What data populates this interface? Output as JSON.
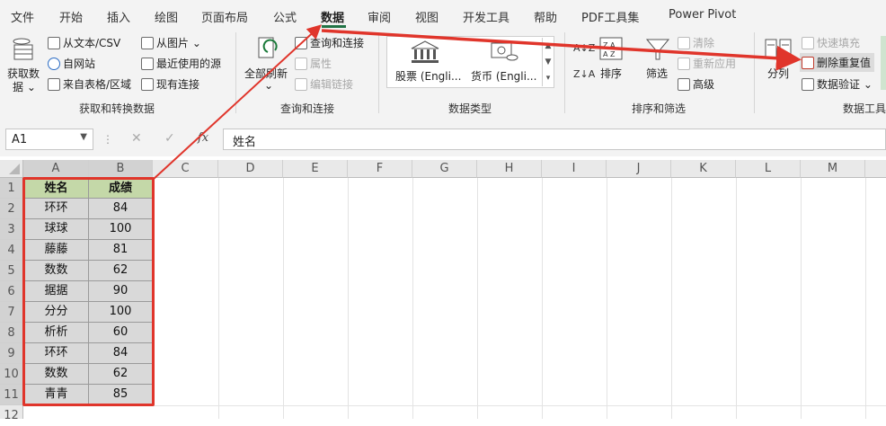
{
  "menu": [
    "文件",
    "开始",
    "插入",
    "绘图",
    "页面布局",
    "公式",
    "数据",
    "审阅",
    "视图",
    "开发工具",
    "帮助",
    "PDF工具集",
    "Power Pivot"
  ],
  "active_tab_index": 6,
  "ribbon": {
    "get_data": {
      "label_top": "获取数",
      "label_bottom": "据 ⌄"
    },
    "from_text_csv": "从文本/CSV",
    "from_web": "自网站",
    "from_table": "来自表格/区域",
    "from_picture": "从图片 ⌄",
    "recent_sources": "最近使用的源",
    "existing_connections": "现有连接",
    "group1": "获取和转换数据",
    "refresh_all": {
      "label_top": "全部刷新",
      "label_bottom": "⌄"
    },
    "queries_connections": "查询和连接",
    "properties": "属性",
    "edit_links": "编辑链接",
    "group2": "查询和连接",
    "stocks": "股票 (Engli...",
    "currency": "货币 (Engli...",
    "group3": "数据类型",
    "sort_az": "A↓Z",
    "sort_za": "Z↓A",
    "sort": "排序",
    "filter": "筛选",
    "clear": "清除",
    "reapply": "重新应用",
    "advanced": "高级",
    "group4": "排序和筛选",
    "text_to_columns": "分列",
    "flash_fill": "快速填充",
    "remove_duplicates": "删除重复值",
    "data_validation": "数据验证 ⌄",
    "group5": "数据工具"
  },
  "formula_bar": {
    "name_box": "A1",
    "cancel": "✕",
    "enter": "✓",
    "fx": "fx",
    "formula": "姓名"
  },
  "columns": [
    "A",
    "B",
    "C",
    "D",
    "E",
    "F",
    "G",
    "H",
    "I",
    "J",
    "K",
    "L",
    "M"
  ],
  "rows": [
    "1",
    "2",
    "3",
    "4",
    "5",
    "6",
    "7",
    "8",
    "9",
    "10",
    "11",
    "12"
  ],
  "table": {
    "headers": [
      "姓名",
      "成绩"
    ],
    "rows": [
      [
        "环环",
        "84"
      ],
      [
        "球球",
        "100"
      ],
      [
        "藤藤",
        "81"
      ],
      [
        "数数",
        "62"
      ],
      [
        "据据",
        "90"
      ],
      [
        "分分",
        "100"
      ],
      [
        "析析",
        "60"
      ],
      [
        "环环",
        "84"
      ],
      [
        "数数",
        "62"
      ],
      [
        "青青",
        "85"
      ]
    ]
  },
  "colors": {
    "header_fill": "#c4d8a8",
    "data_fill": "#d9d9d9",
    "highlight": "#e0352b",
    "accent": "#217346"
  }
}
